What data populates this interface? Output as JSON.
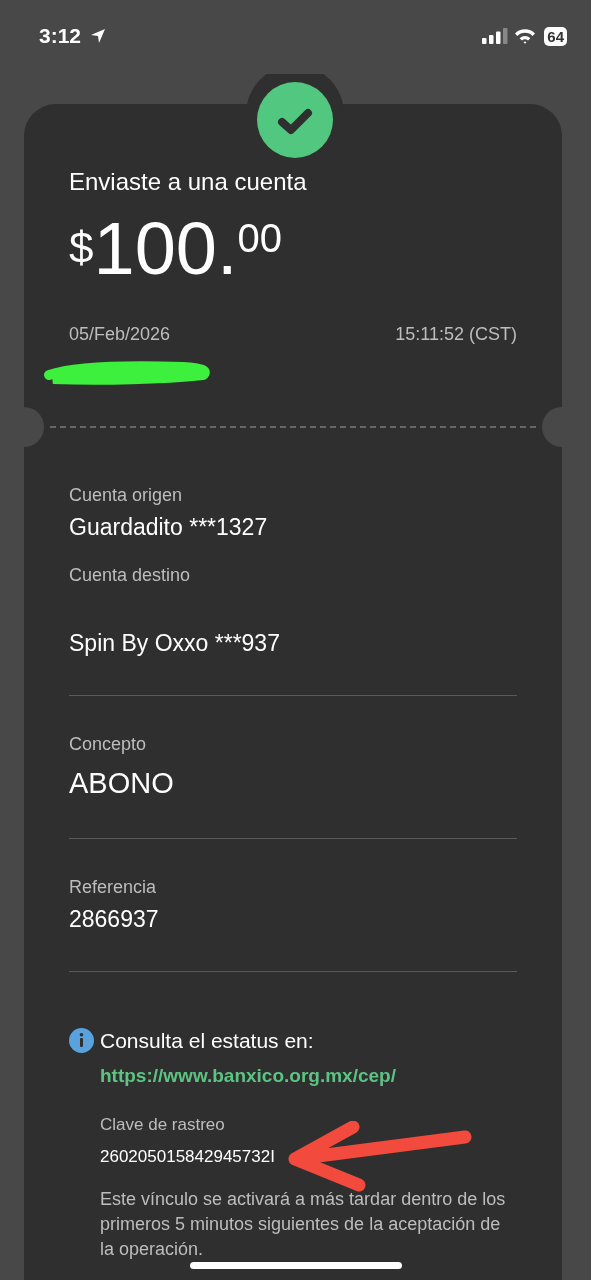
{
  "status_bar": {
    "time": "3:12",
    "battery": "64"
  },
  "receipt": {
    "title": "Enviaste a una cuenta",
    "amount": {
      "currency": "$",
      "whole": "100.",
      "cents": "00"
    },
    "date": "05/Feb/2026",
    "time": "15:11:52 (CST)"
  },
  "sections": [
    {
      "fields": [
        {
          "label": "Cuenta origen",
          "value": "Guardadito ***1327",
          "kind": "normal"
        },
        {
          "label": "Cuenta destino",
          "value": "Spin By Oxxo ***937",
          "kind": "normal"
        }
      ]
    },
    {
      "fields": [
        {
          "label": "Concepto",
          "value": "ABONO",
          "kind": "large"
        }
      ]
    },
    {
      "fields": [
        {
          "label": "Referencia",
          "value": "2866937",
          "kind": "normal"
        }
      ]
    }
  ],
  "status_info": {
    "text": "Consulta el estatus en:",
    "link": "https://www.banxico.org.mx/cep/",
    "tracking_label": "Clave de rastreo",
    "tracking_value": "260205015842945732I",
    "note": "Este vínculo se activará a más tardar dentro de los primeros 5 minutos siguientes de la aceptación de la operación."
  }
}
